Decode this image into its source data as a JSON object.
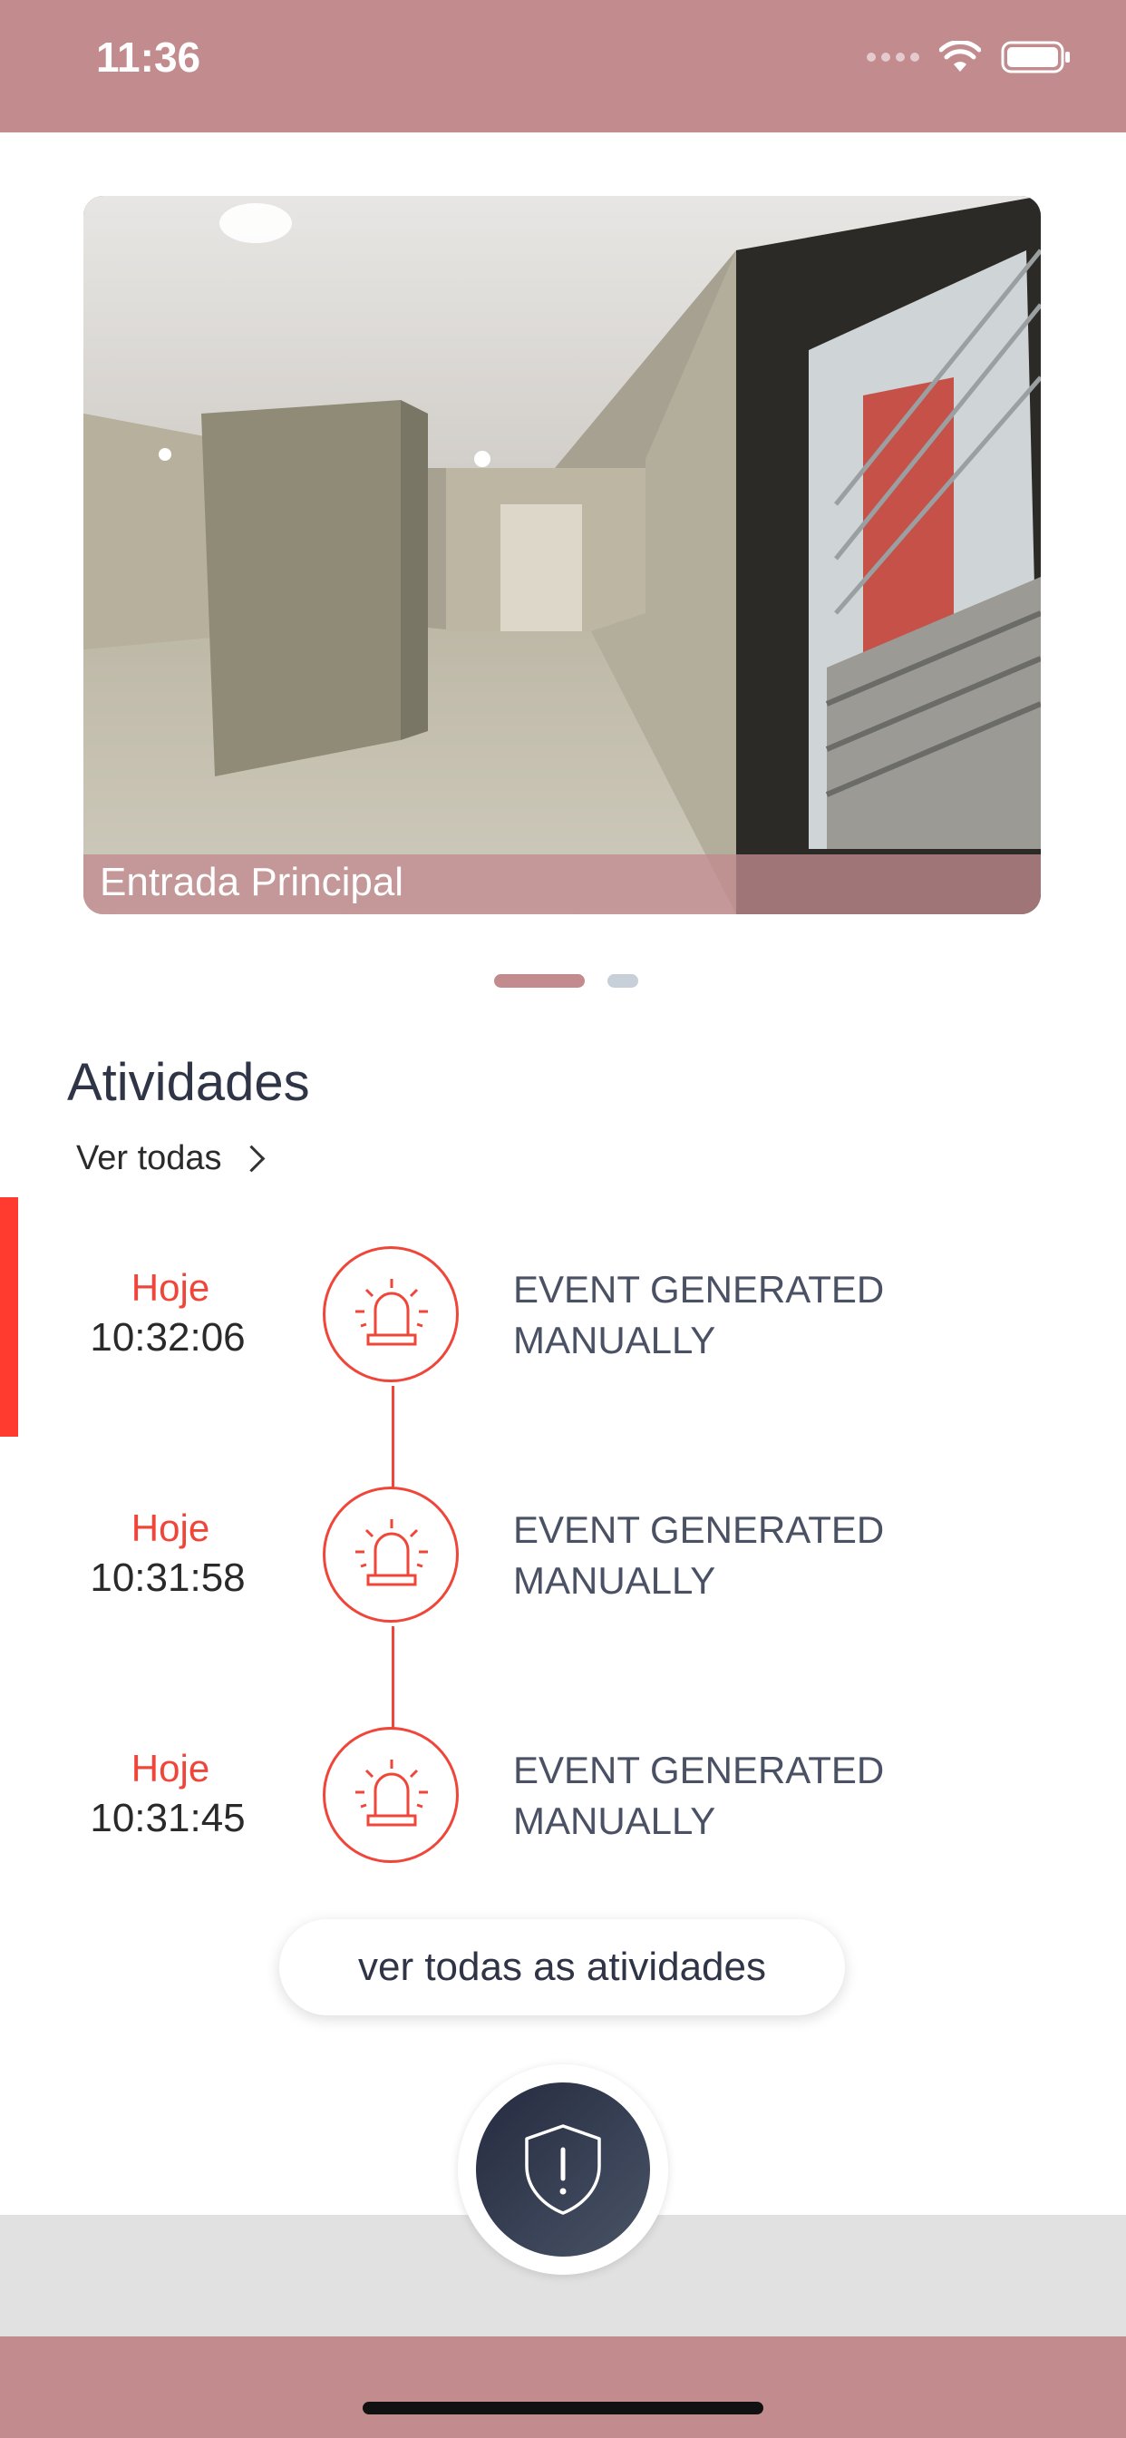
{
  "status_bar": {
    "time": "11:36"
  },
  "camera": {
    "name": "Entrada Principal"
  },
  "activities": {
    "title": "Atividades",
    "see_all_label": "Ver todas",
    "items": [
      {
        "day": "Hoje",
        "time": "10:32:06",
        "description": "EVENT GENERATED MANUALLY"
      },
      {
        "day": "Hoje",
        "time": "10:31:58",
        "description": "EVENT GENERATED MANUALLY"
      },
      {
        "day": "Hoje",
        "time": "10:31:45",
        "description": "EVENT GENERATED MANUALLY"
      }
    ],
    "all_button_label": "ver todas as atividades"
  },
  "icons": {
    "activity": "siren-icon",
    "panic": "shield-alert-icon"
  },
  "colors": {
    "brand": "#c28b8e",
    "alert": "#f0463a",
    "text_dark": "#2f3447"
  }
}
